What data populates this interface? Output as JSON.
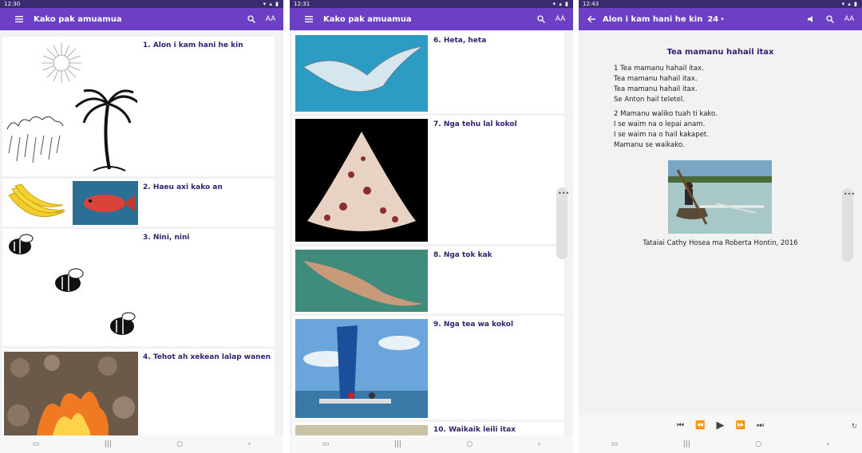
{
  "screens": [
    {
      "time": "12:30",
      "title": "Kako pak amuamua",
      "items": [
        "1. Alon i kam hani he kin",
        "2. Haeu axi kako an",
        "3. Nini, nini",
        "4. Tehot ah xekean lalap wanen"
      ]
    },
    {
      "time": "12:31",
      "title": "Kako pak amuamua",
      "items": [
        "6. Heta, heta",
        "7. Nga tehu lal kokol",
        "8. Nga tok kak",
        "9. Nga tea wa kokol",
        "10. Waikaik leili itax"
      ]
    },
    {
      "time": "12:43",
      "title": "Alon i kam hani he kin",
      "page_number": "24",
      "reading": {
        "heading": "Tea mamanu hahail itax",
        "verse1": [
          "1 Tea mamanu hahail itax.",
          "Tea mamanu hahail itax.",
          "Tea mamanu hahail itax.",
          "Se Anton hail teletel."
        ],
        "verse2": [
          "2 Mamanu waliko tuah ti kako.",
          "I se waim na o lepai anam.",
          "I se waim na o hail kakapet.",
          "Mamanu se waikako."
        ],
        "caption": "Tataiai Cathy Hosea ma Roberta Hontin, 2016"
      }
    }
  ],
  "icons": {
    "menu": "menu-icon",
    "search": "search-icon",
    "text_size": "text-size-icon",
    "back": "back-arrow-icon",
    "speaker": "speaker-icon",
    "more": "more-icon"
  },
  "text_size_label": "AA",
  "colors": {
    "appbar": "#6c3fc4",
    "statusbar": "#3a2b6e",
    "title_text": "#35206f"
  }
}
